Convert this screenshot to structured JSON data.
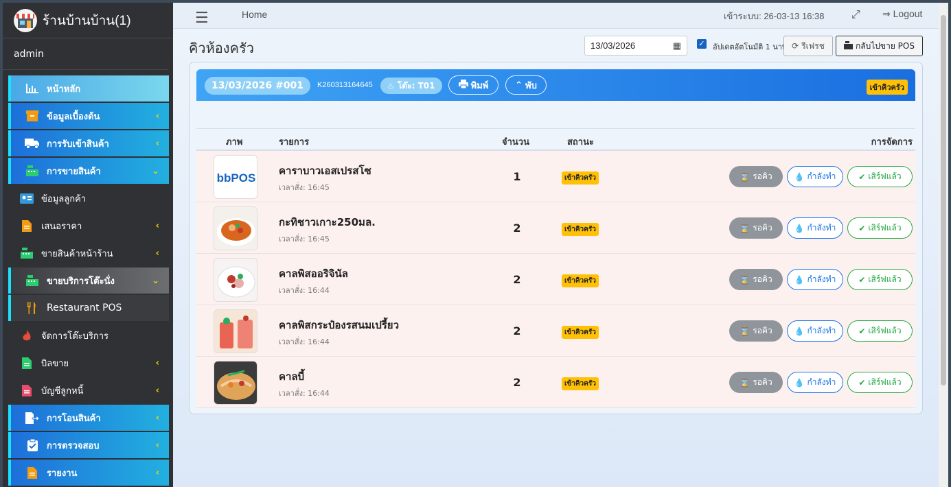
{
  "brand": {
    "title": "ร้านบ้านบ้าน(1)"
  },
  "user": {
    "name": "admin"
  },
  "sidebar": {
    "items": [
      {
        "label": "หน้าหลัก",
        "icon": "chart-icon"
      },
      {
        "label": "ข้อมูลเบื้องต้น",
        "icon": "box-icon"
      },
      {
        "label": "การรับเข้าสินค้า",
        "icon": "truck-icon"
      },
      {
        "label": "การขายสินค้า",
        "icon": "cash-register-icon"
      },
      {
        "label": "ข้อมูลลูกค้า",
        "icon": "id-card-icon"
      },
      {
        "label": "เสนอราคา",
        "icon": "document-icon"
      },
      {
        "label": "ขายสินค้าหน้าร้าน",
        "icon": "cash-register-icon"
      },
      {
        "label": "ขายบริการโต๊ะนั่ง",
        "icon": "cash-register-icon"
      },
      {
        "label": "Restaurant POS",
        "icon": "utensils-icon"
      },
      {
        "label": "จัดการโต๊ะบริการ",
        "icon": "fire-icon"
      },
      {
        "label": "บิลขาย",
        "icon": "document-icon"
      },
      {
        "label": "บัญชีลูกหนี้",
        "icon": "document-icon"
      },
      {
        "label": "การโอนสินค้า",
        "icon": "transfer-icon"
      },
      {
        "label": "การตรวจสอบ",
        "icon": "clipboard-check-icon"
      },
      {
        "label": "รายงาน",
        "icon": "report-icon"
      }
    ]
  },
  "topbar": {
    "home": "Home",
    "login_time": "เข้าระบบ: 26-03-13 16:38",
    "logout": "Logout"
  },
  "page": {
    "title": "คิวห้องครัว",
    "date": "13/03/2026",
    "auto_update_label": "อัปเดตอัตโนมัติ 1 นาที",
    "auto_update_checked": true,
    "refresh_label": "รีเฟรช",
    "back_pos_label": "กลับไปขาย POS"
  },
  "order": {
    "title": "13/03/2026 #001",
    "code": "K260313164645",
    "table": "โต๊ะ: T01",
    "print_label": "พิมพ์",
    "collapse_label": "พับ",
    "status": "เข้าคิวครัว"
  },
  "table": {
    "headers": {
      "image": "ภาพ",
      "item": "รายการ",
      "qty": "จำนวน",
      "status": "สถานะ",
      "actions": "การจัดการ"
    },
    "action_labels": {
      "wait": "รอคิว",
      "cooking": "กำลังทำ",
      "served": "เสิร์ฟแล้ว"
    },
    "rows": [
      {
        "name": "คาราบาวเอสเปรสโซ",
        "time": "เวลาสั่ง: 16:45",
        "qty": "1",
        "status": "เข้าคิวครัว",
        "image": "logo"
      },
      {
        "name": "กะทิชาวเกาะ250มล.",
        "time": "เวลาสั่ง: 16:45",
        "qty": "2",
        "status": "เข้าคิวครัว",
        "image": "soup"
      },
      {
        "name": "คาลพิสออริจินัล",
        "time": "เวลาสั่ง: 16:44",
        "qty": "2",
        "status": "เข้าคิวครัว",
        "image": "salad"
      },
      {
        "name": "คาลพิสกระป๋องรสนมเปรี้ยว",
        "time": "เวลาสั่ง: 16:44",
        "qty": "2",
        "status": "เข้าคิวครัว",
        "image": "drink"
      },
      {
        "name": "คาลบี้",
        "time": "เวลาสั่ง: 16:44",
        "qty": "2",
        "status": "เข้าคิวครัว",
        "image": "padthai"
      }
    ]
  }
}
